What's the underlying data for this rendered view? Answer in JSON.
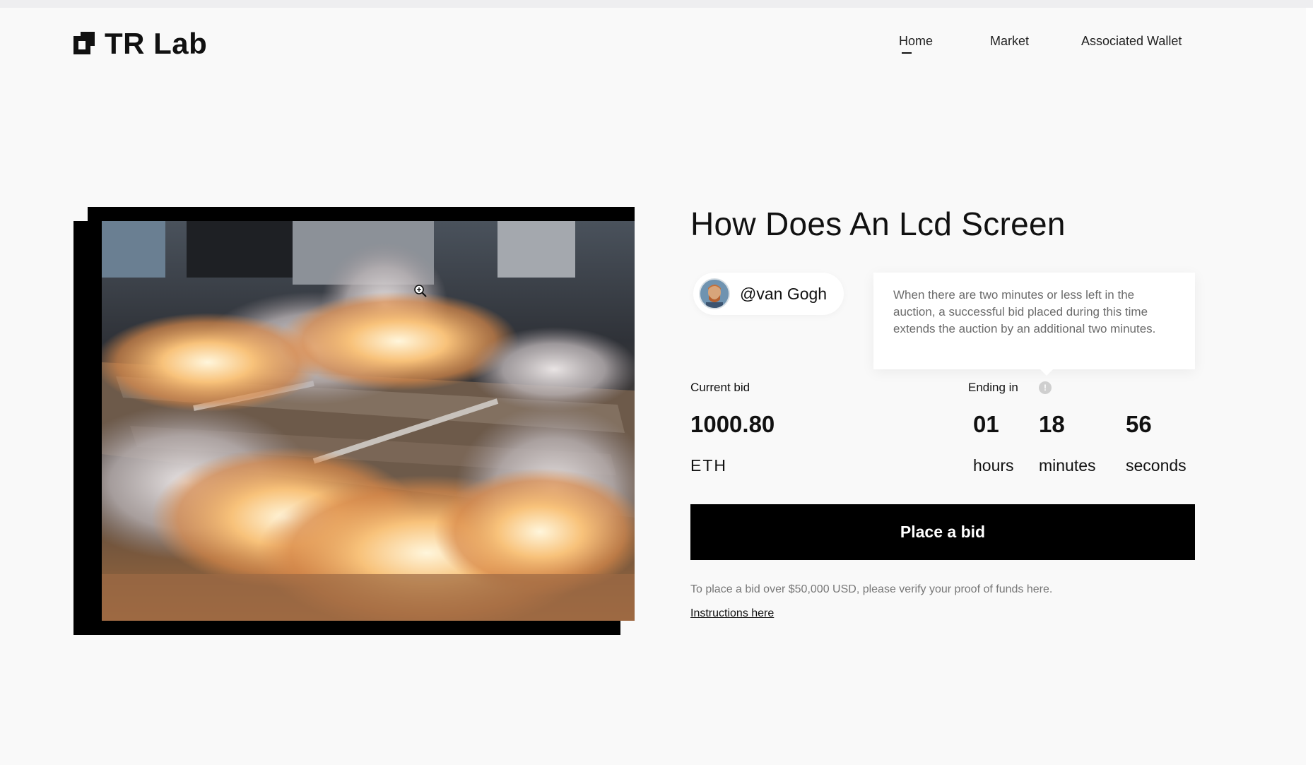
{
  "header": {
    "logo_text": "TR Lab",
    "nav": [
      {
        "label": "Home",
        "active": true
      },
      {
        "label": "Market",
        "active": false
      },
      {
        "label": "Associated Wallet",
        "active": false
      }
    ]
  },
  "artwork": {
    "image_icon": "fire-smoke-artwork",
    "cursor_icon": "zoom-in-cursor-icon"
  },
  "listing": {
    "title": "How Does An Lcd Screen",
    "creator": {
      "name": "@van Gogh",
      "avatar_icon": "van-gogh-portrait-avatar"
    },
    "tooltip_text": "When there are two minutes or less left in the auction, a successful bid placed during this time extends the auction by an additional two minutes.",
    "current_bid_label": "Current bid",
    "current_bid_value": "1000.80",
    "current_bid_unit": "ETH",
    "ending_label": "Ending in",
    "info_icon": "info-icon",
    "countdown": {
      "hours": "01",
      "hours_label": "hours",
      "minutes": "18",
      "minutes_label": "minutes",
      "seconds": "56",
      "seconds_label": "seconds"
    },
    "bid_button_label": "Place a bid",
    "proof_note": "To place a bid over $50,000 USD, please verify your proof of funds here.",
    "instructions_link": "Instructions here"
  },
  "colors": {
    "background": "#f9f9f9",
    "primary": "#000000",
    "text": "#111111",
    "muted": "#777777"
  }
}
